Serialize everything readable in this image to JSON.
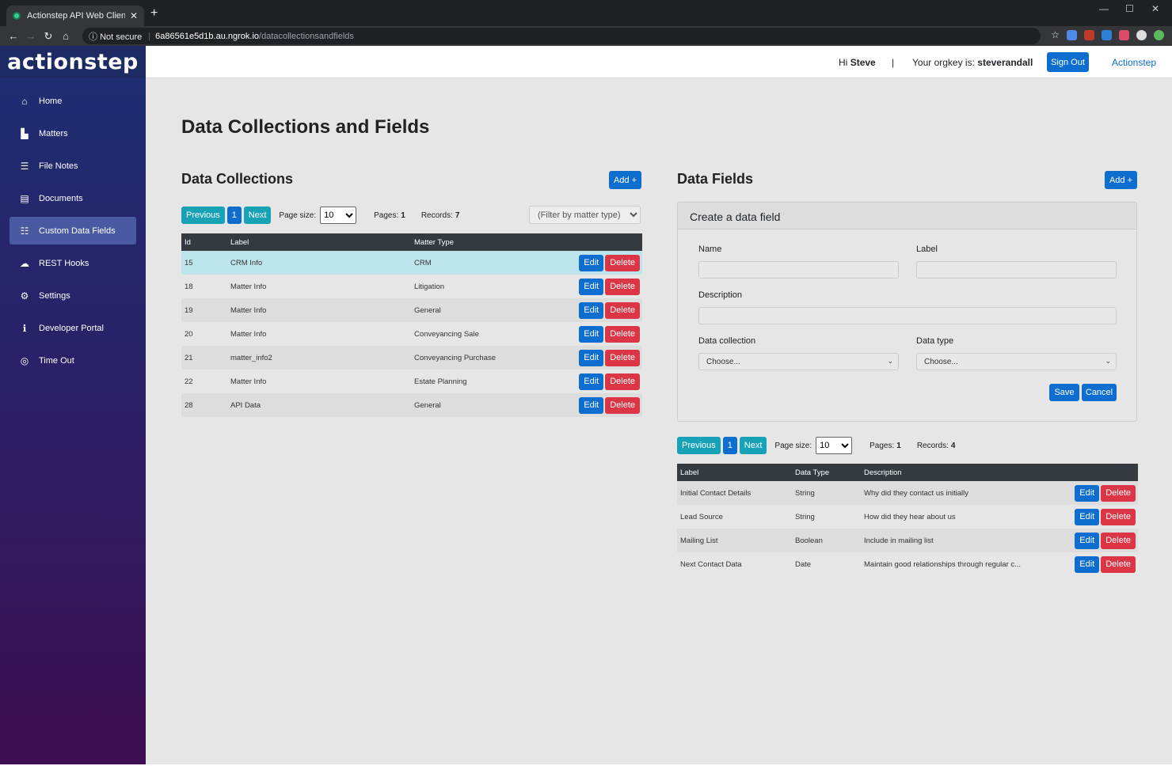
{
  "browser": {
    "tab_title": "Actionstep API Web Client",
    "not_secure": "Not secure",
    "host": "6a86561e5d1b.au.ngrok.io",
    "path": "/datacollectionsandfields"
  },
  "brand": "actionstep",
  "sidebar": {
    "items": [
      {
        "label": "Home",
        "icon": "home-icon"
      },
      {
        "label": "Matters",
        "icon": "file-icon"
      },
      {
        "label": "File Notes",
        "icon": "list-icon"
      },
      {
        "label": "Documents",
        "icon": "documents-icon"
      },
      {
        "label": "Custom Data Fields",
        "icon": "fields-icon"
      },
      {
        "label": "REST Hooks",
        "icon": "cloud-icon"
      },
      {
        "label": "Settings",
        "icon": "gear-icon"
      },
      {
        "label": "Developer Portal",
        "icon": "info-icon"
      },
      {
        "label": "Time Out",
        "icon": "target-icon"
      }
    ]
  },
  "topbar": {
    "hi": "Hi",
    "user": "Steve",
    "pipe": "|",
    "orgkey_label": "Your orgkey is:",
    "orgkey": "steverandall",
    "signout": "Sign Out",
    "link": "Actionstep"
  },
  "page_title": "Data Collections and Fields",
  "collections": {
    "heading": "Data Collections",
    "add": "Add +",
    "pager": {
      "prev": "Previous",
      "page": "1",
      "next": "Next",
      "page_size_label": "Page size:",
      "page_size": "10",
      "pages_label": "Pages:",
      "pages": "1",
      "records_label": "Records:",
      "records": "7"
    },
    "filter_placeholder": "(Filter by matter type)",
    "columns": [
      "Id",
      "Label",
      "Matter Type"
    ],
    "rows": [
      {
        "id": "15",
        "label": "CRM Info",
        "type": "CRM"
      },
      {
        "id": "18",
        "label": "Matter Info",
        "type": "Litigation"
      },
      {
        "id": "19",
        "label": "Matter Info",
        "type": "General"
      },
      {
        "id": "20",
        "label": "Matter Info",
        "type": "Conveyancing Sale"
      },
      {
        "id": "21",
        "label": "matter_info2",
        "type": "Conveyancing Purchase"
      },
      {
        "id": "22",
        "label": "Matter Info",
        "type": "Estate Planning"
      },
      {
        "id": "28",
        "label": "API Data",
        "type": "General"
      }
    ],
    "edit": "Edit",
    "delete": "Delete"
  },
  "fields": {
    "heading": "Data Fields",
    "add": "Add +",
    "form": {
      "title": "Create a data field",
      "name_label": "Name",
      "label_label": "Label",
      "description_label": "Description",
      "collection_label": "Data collection",
      "type_label": "Data type",
      "choose": "Choose...",
      "save": "Save",
      "cancel": "Cancel"
    },
    "pager": {
      "prev": "Previous",
      "page": "1",
      "next": "Next",
      "page_size_label": "Page size:",
      "page_size": "10",
      "pages_label": "Pages:",
      "pages": "1",
      "records_label": "Records:",
      "records": "4"
    },
    "columns": [
      "Label",
      "Data Type",
      "Description"
    ],
    "rows": [
      {
        "label": "Initial Contact Details",
        "type": "String",
        "desc": "Why did they contact us initially"
      },
      {
        "label": "Lead Source",
        "type": "String",
        "desc": "How did they hear about us"
      },
      {
        "label": "Mailing List",
        "type": "Boolean",
        "desc": "Include in mailing list"
      },
      {
        "label": "Next Contact Data",
        "type": "Date",
        "desc": "Maintain good relationships through regular c..."
      }
    ],
    "edit": "Edit",
    "delete": "Delete"
  },
  "colors": {
    "primary": "#0d6ed0",
    "info": "#17a2b8",
    "danger": "#dc3545",
    "sidebar": "#1e2f73"
  }
}
